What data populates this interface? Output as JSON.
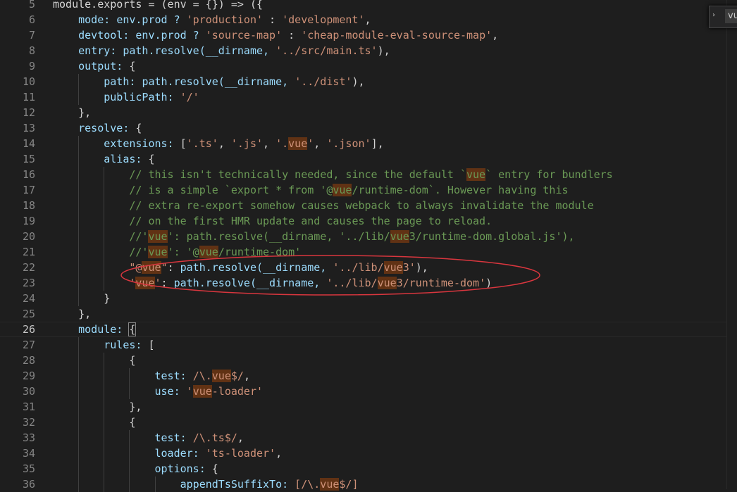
{
  "find_widget": {
    "toggle_glyph": "›",
    "query": "vue"
  },
  "active_line": 26,
  "lines": [
    {
      "n": "5",
      "segs": [
        {
          "t": "module.exports = (env = {}) => ({",
          "c": "p"
        }
      ]
    },
    {
      "n": "6",
      "segs": [
        {
          "t": "    mode: ",
          "c": "k"
        },
        {
          "t": "env.prod ? ",
          "c": "k"
        },
        {
          "t": "'production'",
          "c": "s"
        },
        {
          "t": " : ",
          "c": "p"
        },
        {
          "t": "'development'",
          "c": "s"
        },
        {
          "t": ",",
          "c": "p"
        }
      ]
    },
    {
      "n": "7",
      "segs": [
        {
          "t": "    devtool: ",
          "c": "k"
        },
        {
          "t": "env.prod ? ",
          "c": "k"
        },
        {
          "t": "'source-map'",
          "c": "s"
        },
        {
          "t": " : ",
          "c": "p"
        },
        {
          "t": "'cheap-module-eval-source-map'",
          "c": "s"
        },
        {
          "t": ",",
          "c": "p"
        }
      ]
    },
    {
      "n": "8",
      "segs": [
        {
          "t": "    entry: ",
          "c": "k"
        },
        {
          "t": "path.resolve(__dirname, ",
          "c": "k"
        },
        {
          "t": "'../src/main.ts'",
          "c": "s"
        },
        {
          "t": "),",
          "c": "p"
        }
      ]
    },
    {
      "n": "9",
      "segs": [
        {
          "t": "    output: ",
          "c": "k"
        },
        {
          "t": "{",
          "c": "p"
        }
      ]
    },
    {
      "n": "10",
      "segs": [
        {
          "t": "        path: ",
          "c": "k"
        },
        {
          "t": "path.resolve(__dirname, ",
          "c": "k"
        },
        {
          "t": "'../dist'",
          "c": "s"
        },
        {
          "t": "),",
          "c": "p"
        }
      ]
    },
    {
      "n": "11",
      "segs": [
        {
          "t": "        publicPath: ",
          "c": "k"
        },
        {
          "t": "'/'",
          "c": "s"
        }
      ]
    },
    {
      "n": "12",
      "segs": [
        {
          "t": "    },",
          "c": "p"
        }
      ]
    },
    {
      "n": "13",
      "segs": [
        {
          "t": "    resolve: ",
          "c": "k"
        },
        {
          "t": "{",
          "c": "p"
        }
      ]
    },
    {
      "n": "14",
      "segs": [
        {
          "t": "        extensions: ",
          "c": "k"
        },
        {
          "t": "[",
          "c": "p"
        },
        {
          "t": "'.ts'",
          "c": "s"
        },
        {
          "t": ", ",
          "c": "p"
        },
        {
          "t": "'.js'",
          "c": "s"
        },
        {
          "t": ", ",
          "c": "p"
        },
        {
          "t": "'.",
          "c": "s"
        },
        {
          "t": "vue",
          "c": "s",
          "hl": true
        },
        {
          "t": "'",
          "c": "s"
        },
        {
          "t": ", ",
          "c": "p"
        },
        {
          "t": "'.json'",
          "c": "s"
        },
        {
          "t": "],",
          "c": "p"
        }
      ]
    },
    {
      "n": "15",
      "segs": [
        {
          "t": "        alias: ",
          "c": "k"
        },
        {
          "t": "{",
          "c": "p"
        }
      ]
    },
    {
      "n": "16",
      "segs": [
        {
          "t": "            // this isn't technically needed, since the default `",
          "c": "c"
        },
        {
          "t": "vue",
          "c": "c",
          "hl": true
        },
        {
          "t": "` entry for bundlers",
          "c": "c"
        }
      ]
    },
    {
      "n": "17",
      "segs": [
        {
          "t": "            // is a simple `export * from '@",
          "c": "c"
        },
        {
          "t": "vue",
          "c": "c",
          "hl": true
        },
        {
          "t": "/runtime-dom`. However having this",
          "c": "c"
        }
      ]
    },
    {
      "n": "18",
      "segs": [
        {
          "t": "            // extra re-export somehow causes webpack to always invalidate the module",
          "c": "c"
        }
      ]
    },
    {
      "n": "19",
      "segs": [
        {
          "t": "            // on the first HMR update and causes the page to reload.",
          "c": "c"
        }
      ]
    },
    {
      "n": "20",
      "segs": [
        {
          "t": "            //'",
          "c": "c"
        },
        {
          "t": "vue",
          "c": "c",
          "hl": true
        },
        {
          "t": "': path.resolve(__dirname, '../lib/",
          "c": "c"
        },
        {
          "t": "vue",
          "c": "c",
          "hl": true
        },
        {
          "t": "3/runtime-dom.global.js'),",
          "c": "c"
        }
      ]
    },
    {
      "n": "21",
      "segs": [
        {
          "t": "            //'",
          "c": "c"
        },
        {
          "t": "vue",
          "c": "c",
          "hl": true
        },
        {
          "t": "': '@",
          "c": "c"
        },
        {
          "t": "vue",
          "c": "c",
          "hl": true
        },
        {
          "t": "/runtime-dom'",
          "c": "c"
        }
      ]
    },
    {
      "n": "22",
      "segs": [
        {
          "t": "            \"@",
          "c": "s"
        },
        {
          "t": "vue",
          "c": "s",
          "hl": true
        },
        {
          "t": "\"",
          "c": "s"
        },
        {
          "t": ": ",
          "c": "p"
        },
        {
          "t": "path.resolve(__dirname, ",
          "c": "k"
        },
        {
          "t": "'../lib/",
          "c": "s"
        },
        {
          "t": "vue",
          "c": "s",
          "hl": true
        },
        {
          "t": "3'",
          "c": "s"
        },
        {
          "t": "),",
          "c": "p"
        }
      ]
    },
    {
      "n": "23",
      "segs": [
        {
          "t": "            '",
          "c": "s"
        },
        {
          "t": "vue",
          "c": "s",
          "hl": true
        },
        {
          "t": "'",
          "c": "s"
        },
        {
          "t": ": ",
          "c": "p"
        },
        {
          "t": "path.resolve(__dirname, ",
          "c": "k"
        },
        {
          "t": "'../lib/",
          "c": "s"
        },
        {
          "t": "vue",
          "c": "s",
          "hl": true
        },
        {
          "t": "3/runtime-dom'",
          "c": "s"
        },
        {
          "t": ")",
          "c": "p"
        }
      ]
    },
    {
      "n": "24",
      "segs": [
        {
          "t": "        }",
          "c": "p"
        }
      ]
    },
    {
      "n": "25",
      "segs": [
        {
          "t": "    },",
          "c": "p"
        }
      ]
    },
    {
      "n": "26",
      "segs": [
        {
          "t": "    module: ",
          "c": "k"
        },
        {
          "t": "{",
          "c": "p",
          "bracket": true
        }
      ]
    },
    {
      "n": "27",
      "segs": [
        {
          "t": "        rules: ",
          "c": "k"
        },
        {
          "t": "[",
          "c": "p"
        }
      ]
    },
    {
      "n": "28",
      "segs": [
        {
          "t": "            {",
          "c": "p"
        }
      ]
    },
    {
      "n": "29",
      "segs": [
        {
          "t": "                test: ",
          "c": "k"
        },
        {
          "t": "/\\.",
          "c": "s"
        },
        {
          "t": "vue",
          "c": "s",
          "hl": true
        },
        {
          "t": "$/",
          "c": "s"
        },
        {
          "t": ",",
          "c": "p"
        }
      ]
    },
    {
      "n": "30",
      "segs": [
        {
          "t": "                use: ",
          "c": "k"
        },
        {
          "t": "'",
          "c": "s"
        },
        {
          "t": "vue",
          "c": "s",
          "hl": true
        },
        {
          "t": "-loader'",
          "c": "s"
        }
      ]
    },
    {
      "n": "31",
      "segs": [
        {
          "t": "            },",
          "c": "p"
        }
      ]
    },
    {
      "n": "32",
      "segs": [
        {
          "t": "            {",
          "c": "p"
        }
      ]
    },
    {
      "n": "33",
      "segs": [
        {
          "t": "                test: ",
          "c": "k"
        },
        {
          "t": "/\\.ts$/",
          "c": "s"
        },
        {
          "t": ",",
          "c": "p"
        }
      ]
    },
    {
      "n": "34",
      "segs": [
        {
          "t": "                loader: ",
          "c": "k"
        },
        {
          "t": "'ts-loader'",
          "c": "s"
        },
        {
          "t": ",",
          "c": "p"
        }
      ]
    },
    {
      "n": "35",
      "segs": [
        {
          "t": "                options: ",
          "c": "k"
        },
        {
          "t": "{",
          "c": "p"
        }
      ]
    },
    {
      "n": "36",
      "segs": [
        {
          "t": "                    appendTsSuffixTo: ",
          "c": "k"
        },
        {
          "t": "[/\\.",
          "c": "s"
        },
        {
          "t": "vue",
          "c": "s",
          "hl": true
        },
        {
          "t": "$/]",
          "c": "s"
        }
      ]
    }
  ]
}
